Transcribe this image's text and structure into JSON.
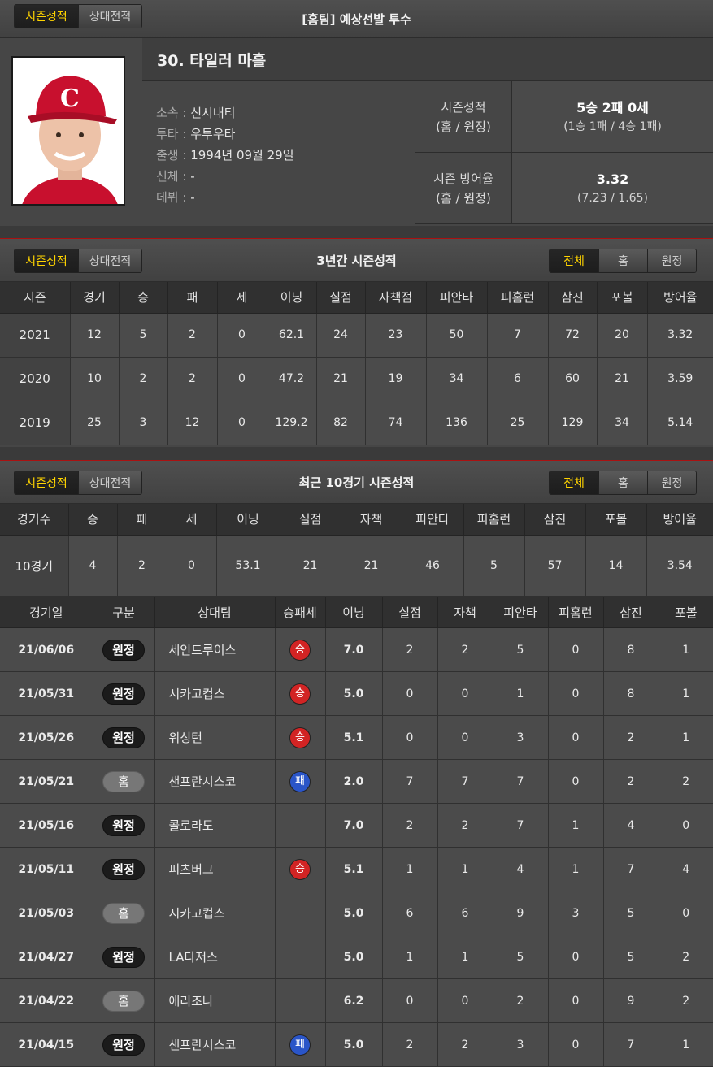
{
  "tabs": [
    "시즌성적",
    "상대전적"
  ],
  "filters": [
    "전체",
    "홈",
    "원정"
  ],
  "player_panel": {
    "title": "[홈팀] 예상선발 투수",
    "name": "30. 타일러 마흘",
    "info": [
      {
        "label": "소속 :",
        "value": "신시내티"
      },
      {
        "label": "투타 :",
        "value": "우투우타"
      },
      {
        "label": "출생 :",
        "value": "1994년 09월 29일"
      },
      {
        "label": "신체 :",
        "value": "-"
      },
      {
        "label": "데뷔 :",
        "value": "-"
      }
    ],
    "season_record": {
      "label1": "시즌성적",
      "label2": "(홈 / 원정)",
      "value": "5승 2패 0세",
      "sub": "(1승 1패 / 4승 1패)"
    },
    "season_era": {
      "label1": "시즌 방어율",
      "label2": "(홈 / 원정)",
      "value": "3.32",
      "sub": "(7.23 / 1.65)"
    }
  },
  "three_year": {
    "title": "3년간 시즌성적",
    "headers": [
      "시즌",
      "경기",
      "승",
      "패",
      "세",
      "이닝",
      "실점",
      "자책점",
      "피안타",
      "피홈런",
      "삼진",
      "포볼",
      "방어율"
    ],
    "rows": [
      [
        "2021",
        "12",
        "5",
        "2",
        "0",
        "62.1",
        "24",
        "23",
        "50",
        "7",
        "72",
        "20",
        "3.32"
      ],
      [
        "2020",
        "10",
        "2",
        "2",
        "0",
        "47.2",
        "21",
        "19",
        "34",
        "6",
        "60",
        "21",
        "3.59"
      ],
      [
        "2019",
        "25",
        "3",
        "12",
        "0",
        "129.2",
        "82",
        "74",
        "136",
        "25",
        "129",
        "34",
        "5.14"
      ]
    ]
  },
  "recent": {
    "title": "최근 10경기 시즌성적",
    "summary_headers": [
      "경기수",
      "승",
      "패",
      "세",
      "이닝",
      "실점",
      "자책",
      "피안타",
      "피홈런",
      "삼진",
      "포볼",
      "방어율"
    ],
    "summary_row": [
      "10경기",
      "4",
      "2",
      "0",
      "53.1",
      "21",
      "21",
      "46",
      "5",
      "57",
      "14",
      "3.54"
    ],
    "game_headers": [
      "경기일",
      "구분",
      "상대팀",
      "승패세",
      "이닝",
      "실점",
      "자책",
      "피안타",
      "피홈런",
      "삼진",
      "포볼"
    ],
    "games": [
      {
        "date": "21/06/06",
        "type": "원정",
        "opp": "세인트루이스",
        "res": "승",
        "ip": "7.0",
        "r": "2",
        "er": "2",
        "h": "5",
        "hr": "0",
        "so": "8",
        "bb": "1"
      },
      {
        "date": "21/05/31",
        "type": "원정",
        "opp": "시카고컵스",
        "res": "승",
        "ip": "5.0",
        "r": "0",
        "er": "0",
        "h": "1",
        "hr": "0",
        "so": "8",
        "bb": "1"
      },
      {
        "date": "21/05/26",
        "type": "원정",
        "opp": "워싱턴",
        "res": "승",
        "ip": "5.1",
        "r": "0",
        "er": "0",
        "h": "3",
        "hr": "0",
        "so": "2",
        "bb": "1"
      },
      {
        "date": "21/05/21",
        "type": "홈",
        "opp": "샌프란시스코",
        "res": "패",
        "ip": "2.0",
        "r": "7",
        "er": "7",
        "h": "7",
        "hr": "0",
        "so": "2",
        "bb": "2"
      },
      {
        "date": "21/05/16",
        "type": "원정",
        "opp": "콜로라도",
        "res": "",
        "ip": "7.0",
        "r": "2",
        "er": "2",
        "h": "7",
        "hr": "1",
        "so": "4",
        "bb": "0"
      },
      {
        "date": "21/05/11",
        "type": "원정",
        "opp": "피츠버그",
        "res": "승",
        "ip": "5.1",
        "r": "1",
        "er": "1",
        "h": "4",
        "hr": "1",
        "so": "7",
        "bb": "4"
      },
      {
        "date": "21/05/03",
        "type": "홈",
        "opp": "시카고컵스",
        "res": "",
        "ip": "5.0",
        "r": "6",
        "er": "6",
        "h": "9",
        "hr": "3",
        "so": "5",
        "bb": "0"
      },
      {
        "date": "21/04/27",
        "type": "원정",
        "opp": "LA다저스",
        "res": "",
        "ip": "5.0",
        "r": "1",
        "er": "1",
        "h": "5",
        "hr": "0",
        "so": "5",
        "bb": "2"
      },
      {
        "date": "21/04/22",
        "type": "홈",
        "opp": "애리조나",
        "res": "",
        "ip": "6.2",
        "r": "0",
        "er": "0",
        "h": "2",
        "hr": "0",
        "so": "9",
        "bb": "2"
      },
      {
        "date": "21/04/15",
        "type": "원정",
        "opp": "샌프란시스코",
        "res": "패",
        "ip": "5.0",
        "r": "2",
        "er": "2",
        "h": "3",
        "hr": "0",
        "so": "7",
        "bb": "1"
      }
    ]
  },
  "colors": {
    "win": "#d22424",
    "loss": "#2a55c8",
    "active_tab": "#ffd400"
  }
}
